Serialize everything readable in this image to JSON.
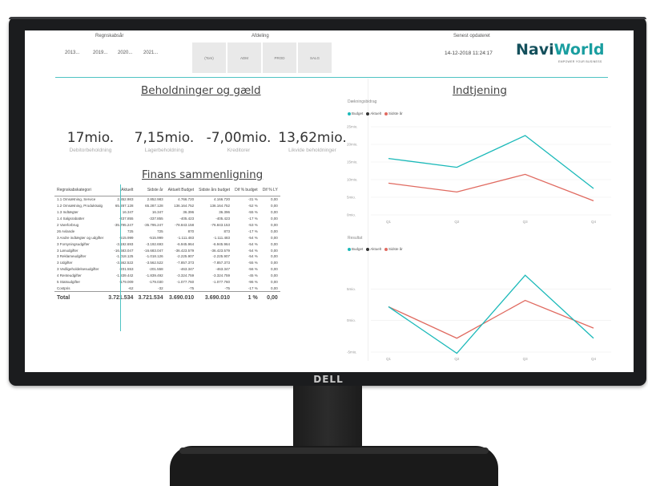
{
  "monitor": {
    "brand": "DELL"
  },
  "header": {
    "year_label": "Regnskabsår",
    "years": [
      "2013...",
      "2019...",
      "2020...",
      "2021..."
    ],
    "dept_label": "Afdeling",
    "depts": [
      "(Tom)",
      "ADM",
      "PROD",
      "SALG"
    ],
    "updated_label": "Senest opdateret",
    "updated_value": "14-12-2018 11:24:17",
    "logo_a": "Navi",
    "logo_b": "World",
    "logo_tagline": "EMPOWER YOUR BUSINESS"
  },
  "holdings": {
    "title": "Beholdninger og gæld",
    "kpis": [
      {
        "value": "17mio.",
        "label": "Debitorbeholdning"
      },
      {
        "value": "7,15mio.",
        "label": "Lagerbeholdning"
      },
      {
        "value": "-7,00mio.",
        "label": "Kreditorer"
      },
      {
        "value": "13,62mio.",
        "label": "Likvide beholdninger"
      }
    ]
  },
  "finance": {
    "title": "Finans sammenligning",
    "columns": [
      "Regnskabskategori",
      "Aktuelt",
      "Sidste år",
      "Aktuelt Budget",
      "Sidste års budget",
      "Dif % budget",
      "Dif % LY"
    ],
    "rows": [
      [
        "1.1 Omsætning, Service",
        "2.852.983",
        "2.852.983",
        "4.766.720",
        "4.166.720",
        "-31 %",
        "0,00"
      ],
      [
        "1.2 Omsætning, Produktsalg",
        "65.287.128",
        "65.287.128",
        "136.164.752",
        "136.164.752",
        "-52 %",
        "0,00"
      ],
      [
        "1.3 Indtægter",
        "16.347",
        "16.347",
        "36.396",
        "36.396",
        "-55 %",
        "0,00"
      ],
      [
        "1.4 Salgsrabatter",
        "-337.855",
        "-337.855",
        "-405.423",
        "-405.423",
        "-17 %",
        "0,00"
      ],
      [
        "2 Vareforbrug",
        "-35.795.247",
        "-35.795.247",
        "-78.843.158",
        "-76.843.153",
        "-53 %",
        "0,00"
      ],
      [
        "26 Avlande",
        "725",
        "725",
        "870",
        "873",
        "-17 %",
        "0,00"
      ],
      [
        "3 Andre indtægter og udgifter",
        "-515.999",
        "-515.999",
        "-1.111.483",
        "-1.111.483",
        "-54 %",
        "0,00"
      ],
      [
        "3 Forsyningsudgifter",
        "-3.192.693",
        "-3.192.693",
        "-6.945.964",
        "-6.945.964",
        "-54 %",
        "0,00"
      ],
      [
        "3 Lønudgifter",
        "-16.683.047",
        "-16.683.047",
        "-36.423.579",
        "-36.423.579",
        "-54 %",
        "0,00"
      ],
      [
        "3 Reklameudgifter",
        "-1.018.125",
        "-1.018.126",
        "-2.225.907",
        "-2.225.907",
        "-54 %",
        "0,00"
      ],
      [
        "3 Udgifter",
        "-3.562.522",
        "-3.562.522",
        "-7.857.373",
        "-7.857.373",
        "-55 %",
        "0,00"
      ],
      [
        "3 Vedligeholdelsesudgifter",
        "-201.553",
        "-201.558",
        "-463.347",
        "-463.347",
        "-56 %",
        "0,00"
      ],
      [
        "4 Renteudgifter",
        "-1.839.442",
        "-1.839.492",
        "-3.324.759",
        "-3.324.759",
        "-45 %",
        "0,00"
      ],
      [
        "5 Statsudgifter",
        "-179.009",
        "-179.030",
        "-1.077.760",
        "-1.077.760",
        "-96 %",
        "0,00"
      ],
      [
        "Costpris",
        "-62",
        "-32",
        "-75",
        "-75",
        "-17 %",
        "0,00"
      ]
    ],
    "total": [
      "Total",
      "3.721.534",
      "3.721.534",
      "3.690.010",
      "3.690.010",
      "1 %",
      "0,00"
    ]
  },
  "earnings": {
    "title": "Indtjening",
    "colors": {
      "budget": "#1bb9b9",
      "actual": "#333333",
      "last": "#e06a60"
    }
  },
  "chart_data": [
    {
      "type": "line",
      "title": "Dækningsbidrag",
      "categories": [
        "Q1",
        "Q2",
        "Q3",
        "Q4"
      ],
      "yticks": [
        "25mio.",
        "20mio.",
        "15mio.",
        "10mio.",
        "5mio.",
        "0mio."
      ],
      "ylim": [
        0,
        25
      ],
      "series": [
        {
          "name": "Budget",
          "values": [
            16,
            13.5,
            22.5,
            7.5
          ]
        },
        {
          "name": "Aktuelt",
          "values": [
            9,
            6.5,
            11.5,
            4
          ]
        },
        {
          "name": "Sidste år",
          "values": [
            9,
            6.5,
            11.5,
            4
          ]
        }
      ]
    },
    {
      "type": "line",
      "title": "Resultat",
      "categories": [
        "Q1",
        "Q2",
        "Q3",
        "Q4"
      ],
      "yticks": [
        "5mio.",
        "0mio.",
        "-5mio."
      ],
      "ylim": [
        -5,
        9
      ],
      "series": [
        {
          "name": "Budget",
          "values": [
            2.2,
            -5.2,
            7.2,
            -2.8
          ]
        },
        {
          "name": "Aktuelt",
          "values": [
            2.2,
            -2.8,
            3.2,
            -1.2
          ]
        },
        {
          "name": "Sidste år",
          "values": [
            2.2,
            -2.8,
            3.2,
            -1.2
          ]
        }
      ]
    }
  ]
}
